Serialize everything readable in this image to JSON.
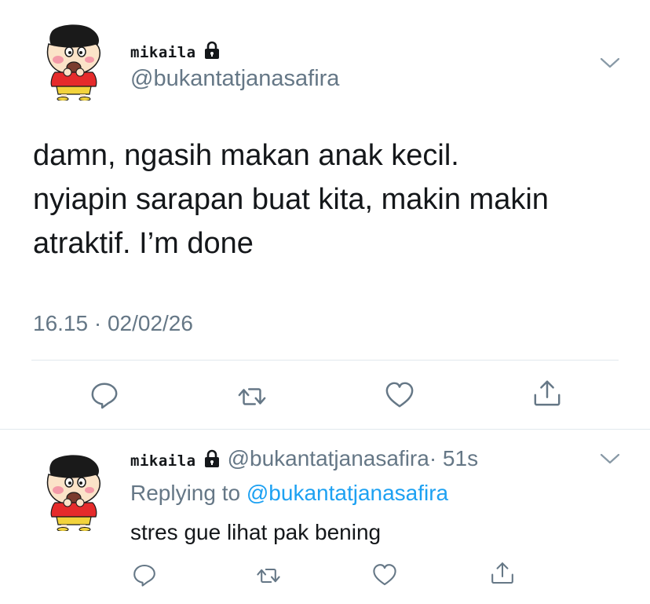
{
  "tweet": {
    "display_name": "mikaila",
    "handle": "@bukantatjanasafira",
    "text_lines": [
      "damn, ngasih makan anak kecil.",
      "nyiapin sarapan buat kita, makin makin",
      "atraktif. I’m done"
    ],
    "timestamp": "16.15 · 02/02/26"
  },
  "reply": {
    "display_name": "mikaila",
    "handle": "@bukantatjanasafira",
    "time": "· 51s",
    "replying_prefix": "Replying to ",
    "replying_to": "@bukantatjanasafira",
    "text": "stres gue lihat pak bening"
  },
  "icons": {
    "lock": "lock-icon",
    "chevron": "chevron-down-icon",
    "reply": "reply-icon",
    "retweet": "retweet-icon",
    "like": "heart-icon",
    "share": "share-icon"
  },
  "colors": {
    "text": "#14171a",
    "secondary": "#657786",
    "link": "#1da1f2",
    "divider": "#e1e8ed"
  }
}
